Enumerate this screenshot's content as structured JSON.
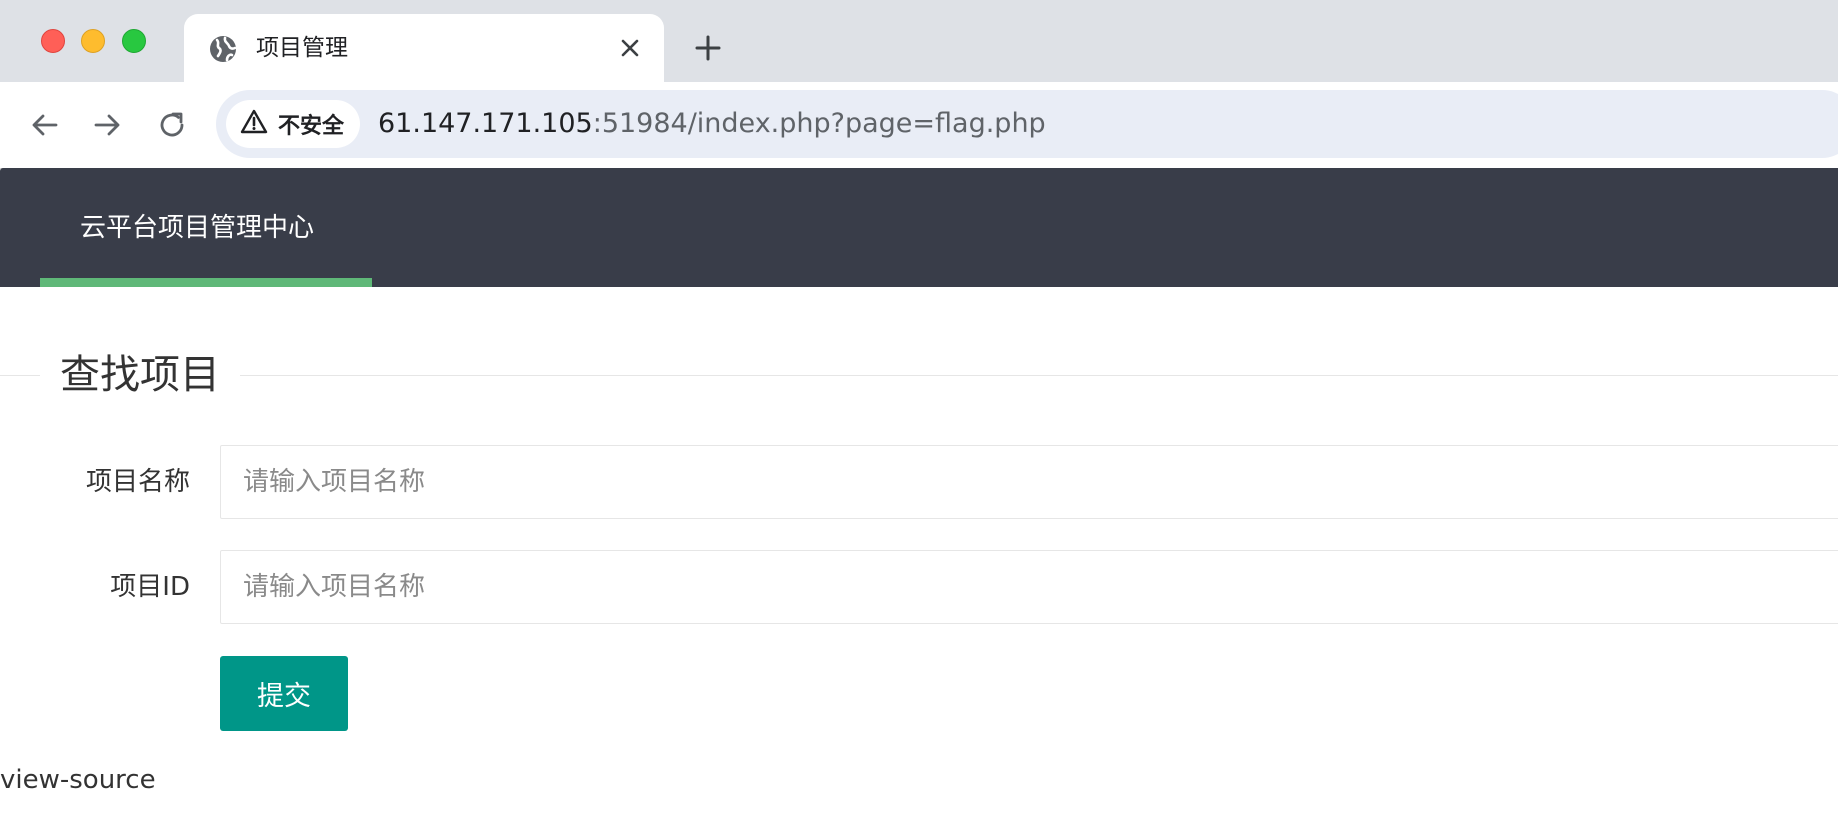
{
  "browser": {
    "tab": {
      "title": "项目管理",
      "icon": "globe-icon",
      "close_icon": "close-icon"
    },
    "new_tab_icon": "plus-icon",
    "nav": {
      "back_icon": "arrow-left-icon",
      "forward_icon": "arrow-right-icon",
      "reload_icon": "reload-icon"
    },
    "address_bar": {
      "security_label": "不安全",
      "security_icon": "warning-icon",
      "url_host": "61.147.171.105",
      "url_rest": ":51984/index.php?page=flag.php"
    },
    "window_controls": {
      "close_color": "#ff5f57",
      "minimize_color": "#febc2e",
      "zoom_color": "#28c840"
    }
  },
  "header": {
    "nav_item_label": "云平台项目管理中心",
    "background_color": "#393d49",
    "active_underline_color": "#5fb878"
  },
  "form": {
    "legend": "查找项目",
    "fields": [
      {
        "label": "项目名称",
        "placeholder": "请输入项目名称",
        "value": ""
      },
      {
        "label": "项目ID",
        "placeholder": "请输入项目名称",
        "value": ""
      }
    ],
    "submit_label": "提交",
    "submit_color": "#009688"
  },
  "footer_text": "view-source"
}
